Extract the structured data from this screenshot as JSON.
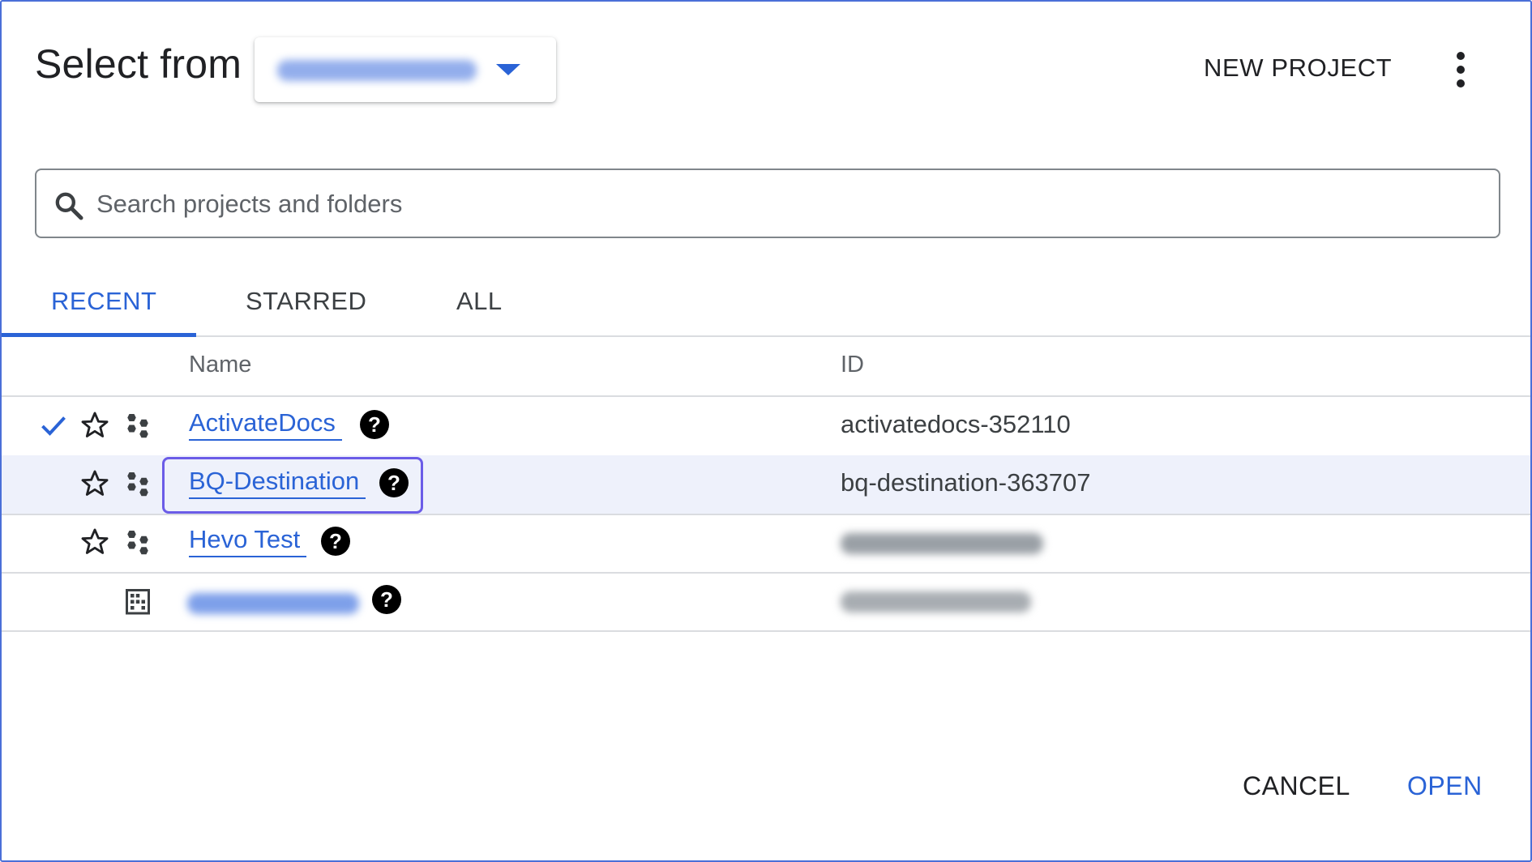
{
  "dialog": {
    "title": "Select from",
    "org_selector": {
      "value": "",
      "caret_icon": "caret-down-icon"
    },
    "new_project_label": "NEW PROJECT",
    "more_icon": "more-vert-icon"
  },
  "search": {
    "placeholder": "Search projects and folders",
    "value": "",
    "icon": "search-icon"
  },
  "tabs": [
    {
      "label": "RECENT",
      "active": true
    },
    {
      "label": "STARRED",
      "active": false
    },
    {
      "label": "ALL",
      "active": false
    }
  ],
  "table": {
    "headers": {
      "name": "Name",
      "id": "ID"
    },
    "rows": [
      {
        "name": "ActivateDocs",
        "id": "activatedocs-352110",
        "current": true,
        "type": "project"
      },
      {
        "name": "BQ-Destination",
        "id": "bq-destination-363707",
        "current": false,
        "type": "project",
        "selected": true
      },
      {
        "name": "Hevo Test",
        "id": "",
        "current": false,
        "type": "project"
      },
      {
        "name": "",
        "id": "",
        "current": false,
        "type": "organization"
      }
    ],
    "help_glyph": "?"
  },
  "footer": {
    "cancel_label": "CANCEL",
    "open_label": "OPEN"
  },
  "colors": {
    "accent": "#2a63d6",
    "focus_ring": "#6b5ce7",
    "selected_row": "#eef1fb",
    "divider": "#dadce0"
  }
}
